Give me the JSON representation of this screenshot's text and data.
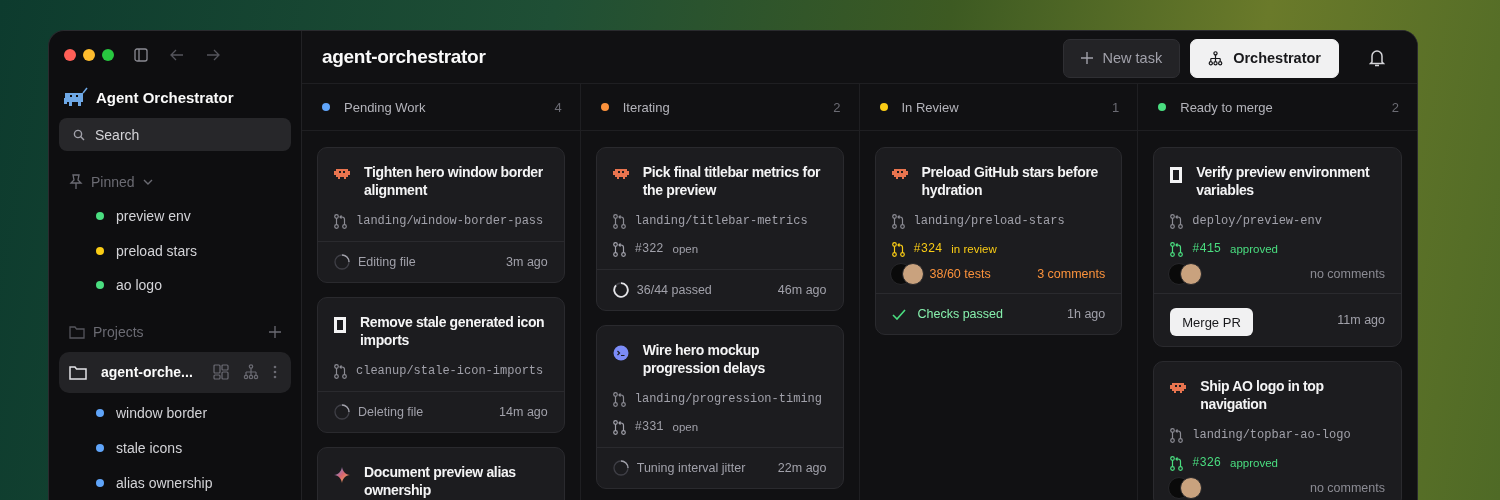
{
  "sidebar": {
    "title": "Agent Orchestrator",
    "search": {
      "placeholder": "Search"
    },
    "pinned": {
      "label": "Pinned",
      "expanded": true,
      "items": [
        {
          "label": "preview env",
          "color": "#4ade80"
        },
        {
          "label": "preload stars",
          "color": "#facc15"
        },
        {
          "label": "ao logo",
          "color": "#4ade80"
        }
      ]
    },
    "projects": {
      "label": "Projects",
      "items": [
        {
          "name": "agent-orche...",
          "selected": true,
          "sessions": [
            {
              "label": "window border",
              "color": "#60a5fa"
            },
            {
              "label": "stale icons",
              "color": "#60a5fa"
            },
            {
              "label": "alias ownership",
              "color": "#60a5fa"
            }
          ]
        }
      ]
    }
  },
  "header": {
    "title": "agent-orchestrator",
    "buttons": [
      {
        "label": "New task",
        "kind": "secondary"
      },
      {
        "label": "Orchestrator",
        "kind": "primary"
      }
    ]
  },
  "columns": [
    {
      "title": "Pending Work",
      "count": "4",
      "color": "#60a5fa",
      "cards": [
        {
          "kind": "robot",
          "title": "Tighten hero window border alignment",
          "branch": "landing/window-border-pass",
          "footer": {
            "kind": "spinner",
            "text": "Editing file",
            "time": "3m ago"
          }
        },
        {
          "kind": "square",
          "title": "Remove stale generated icon imports",
          "branch": "cleanup/stale-icon-imports",
          "footer": {
            "kind": "spinner",
            "text": "Deleting file",
            "time": "14m ago"
          }
        },
        {
          "kind": "sparkle",
          "title": "Document preview alias ownership"
        }
      ]
    },
    {
      "title": "Iterating",
      "count": "2",
      "color": "#fb923c",
      "cards": [
        {
          "kind": "robot",
          "title": "Pick final titlebar metrics for the preview",
          "branch": "landing/titlebar-metrics",
          "pr": {
            "number": "#322",
            "status": "open",
            "kind": "open"
          },
          "footer": {
            "kind": "progress",
            "text": "36/44 passed",
            "time": "46m ago"
          }
        },
        {
          "kind": "terminal",
          "title": "Wire hero mockup progression delays",
          "branch": "landing/progression-timing",
          "pr": {
            "number": "#331",
            "status": "open",
            "kind": "open"
          },
          "footer": {
            "kind": "spinner",
            "text": "Tuning interval jitter",
            "time": "22m ago"
          }
        }
      ]
    },
    {
      "title": "In Review",
      "count": "1",
      "color": "#facc15",
      "cards": [
        {
          "kind": "robot",
          "title": "Preload GitHub stars before hydration",
          "branch": "landing/preload-stars",
          "pr": {
            "number": "#324",
            "status": "in review",
            "kind": "review"
          },
          "activity": {
            "tests": "38/60 tests",
            "comments": "3 comments",
            "kind": "warning"
          },
          "footer": {
            "kind": "check",
            "text": "Checks passed",
            "time": "1h ago"
          }
        }
      ]
    },
    {
      "title": "Ready to merge",
      "count": "2",
      "color": "#4ade80",
      "cards": [
        {
          "kind": "square",
          "title": "Verify preview environment variables",
          "branch": "deploy/preview-env",
          "pr": {
            "number": "#415",
            "status": "approved",
            "kind": "approved"
          },
          "activity": {
            "comments": "no comments",
            "kind": "muted"
          },
          "footer": {
            "kind": "button",
            "text": "Merge PR",
            "time": "11m ago"
          }
        },
        {
          "kind": "robot",
          "title": "Ship AO logo in top navigation",
          "branch": "landing/topbar-ao-logo",
          "pr": {
            "number": "#326",
            "status": "approved",
            "kind": "approved"
          },
          "activity": {
            "comments": "no comments",
            "kind": "muted"
          }
        }
      ]
    }
  ]
}
